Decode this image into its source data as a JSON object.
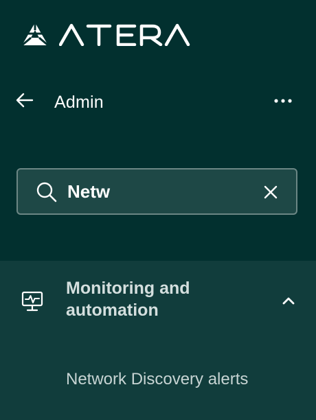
{
  "brand": {
    "name": "ATERA",
    "icon": "atera-logo-icon"
  },
  "header": {
    "title": "Admin",
    "back_icon": "arrow-left-icon",
    "more_icon": "more-horizontal-icon"
  },
  "search": {
    "value": "Netw",
    "icon": "search-icon",
    "clear_icon": "close-icon"
  },
  "nav": {
    "section": {
      "label": "Monitoring and automation",
      "icon": "monitor-pulse-icon",
      "expanded": true,
      "chevron_icon": "chevron-up-icon"
    },
    "items": [
      {
        "label": "Network Discovery alerts"
      }
    ]
  },
  "colors": {
    "background": "#02302f",
    "section_background": "#113d3c",
    "search_background": "#1e4846",
    "search_border": "#6c8785",
    "text_primary": "#ffffff",
    "text_muted": "#c7d4d3"
  }
}
